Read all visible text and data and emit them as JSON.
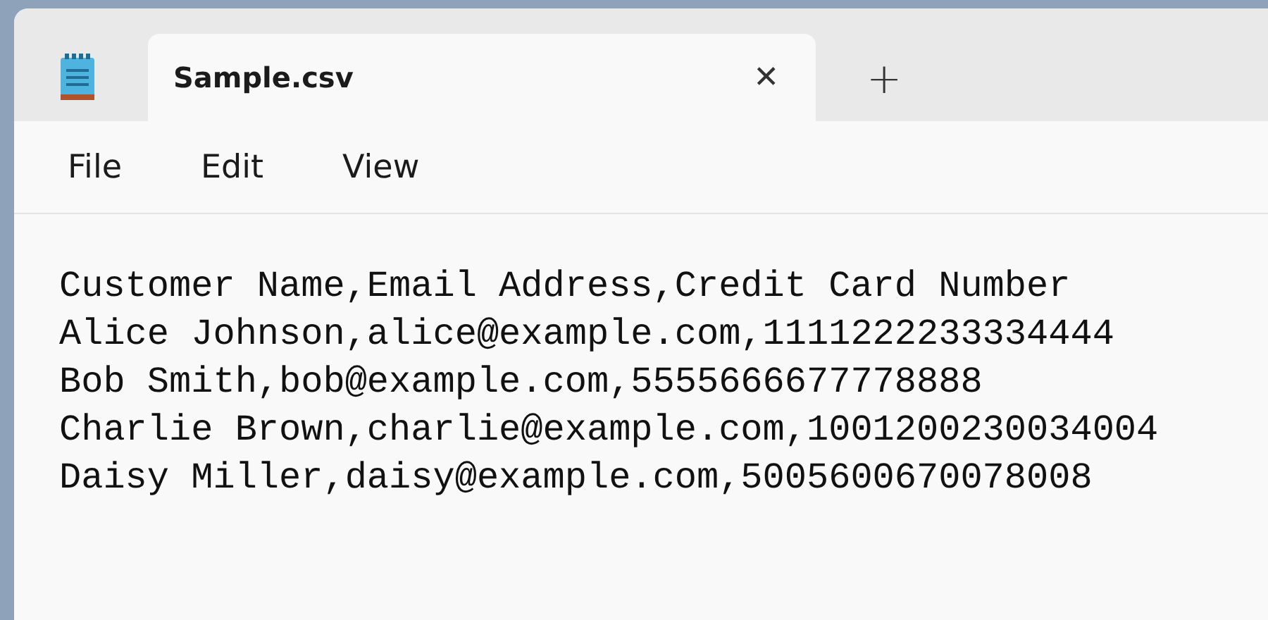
{
  "tabs": [
    {
      "title": "Sample.csv",
      "selected": true,
      "close": "✕"
    }
  ],
  "new_tab": "+",
  "menu": [
    "File",
    "Edit",
    "View"
  ],
  "editor": {
    "lines": [
      "Customer Name,Email Address,Credit Card Number",
      "Alice Johnson,alice@example.com,1111222233334444",
      "Bob Smith,bob@example.com,5555666677778888",
      "Charlie Brown,charlie@example.com,1001200230034004",
      "Daisy Miller,daisy@example.com,5005600670078008"
    ]
  }
}
